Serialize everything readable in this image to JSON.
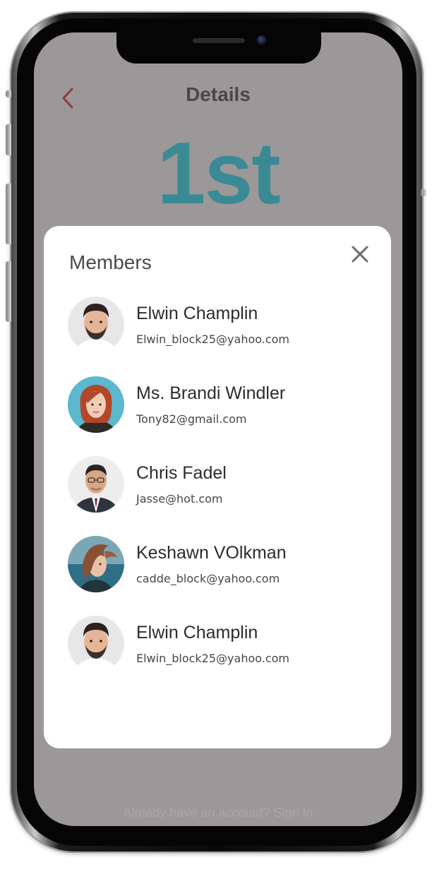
{
  "header": {
    "title": "Details",
    "back_icon": "chevron-left-icon"
  },
  "rank": "1st",
  "footer": {
    "text": "Already have an account? Sign In"
  },
  "modal": {
    "title": "Members",
    "close_icon": "close-icon",
    "members": [
      {
        "name": "Elwin Champlin",
        "email": "Elwin_block25@yahoo.com",
        "avatar": "avatar-man-beard"
      },
      {
        "name": "Ms. Brandi Windler",
        "email": "Tony82@gmail.com",
        "avatar": "avatar-woman-redhair"
      },
      {
        "name": "Chris Fadel",
        "email": "Jasse@hot.com",
        "avatar": "avatar-man-glasses-suit"
      },
      {
        "name": "Keshawn VOlkman",
        "email": "cadde_block@yahoo.com",
        "avatar": "avatar-woman-windy-hair"
      },
      {
        "name": "Elwin Champlin",
        "email": "Elwin_block25@yahoo.com",
        "avatar": "avatar-man-beard"
      }
    ]
  },
  "colors": {
    "screen_bg": "#9c9899",
    "rank": "#3a8a95",
    "back_icon": "#8e3a3e",
    "modal_bg": "#ffffff"
  }
}
